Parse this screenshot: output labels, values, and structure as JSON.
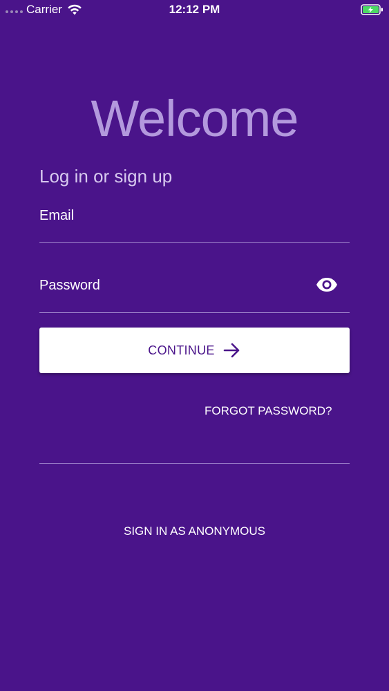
{
  "status_bar": {
    "carrier": "Carrier",
    "time": "12:12 PM",
    "wifi_icon": "wifi-icon",
    "battery_icon": "battery-charging-icon",
    "battery_color": "#4cd964"
  },
  "header": {
    "title": "Welcome",
    "subtitle": "Log in or sign up"
  },
  "form": {
    "email_label": "Email",
    "email_value": "",
    "password_label": "Password",
    "password_value": "",
    "show_password_icon": "eye-icon"
  },
  "actions": {
    "continue_label": "CONTINUE",
    "continue_icon": "arrow-right-icon",
    "forgot_password_label": "FORGOT PASSWORD?",
    "anonymous_label": "SIGN IN AS ANONYMOUS"
  },
  "colors": {
    "background": "#4a148a",
    "title": "#b399dd",
    "button_bg": "#ffffff",
    "button_text": "#4a148a"
  }
}
